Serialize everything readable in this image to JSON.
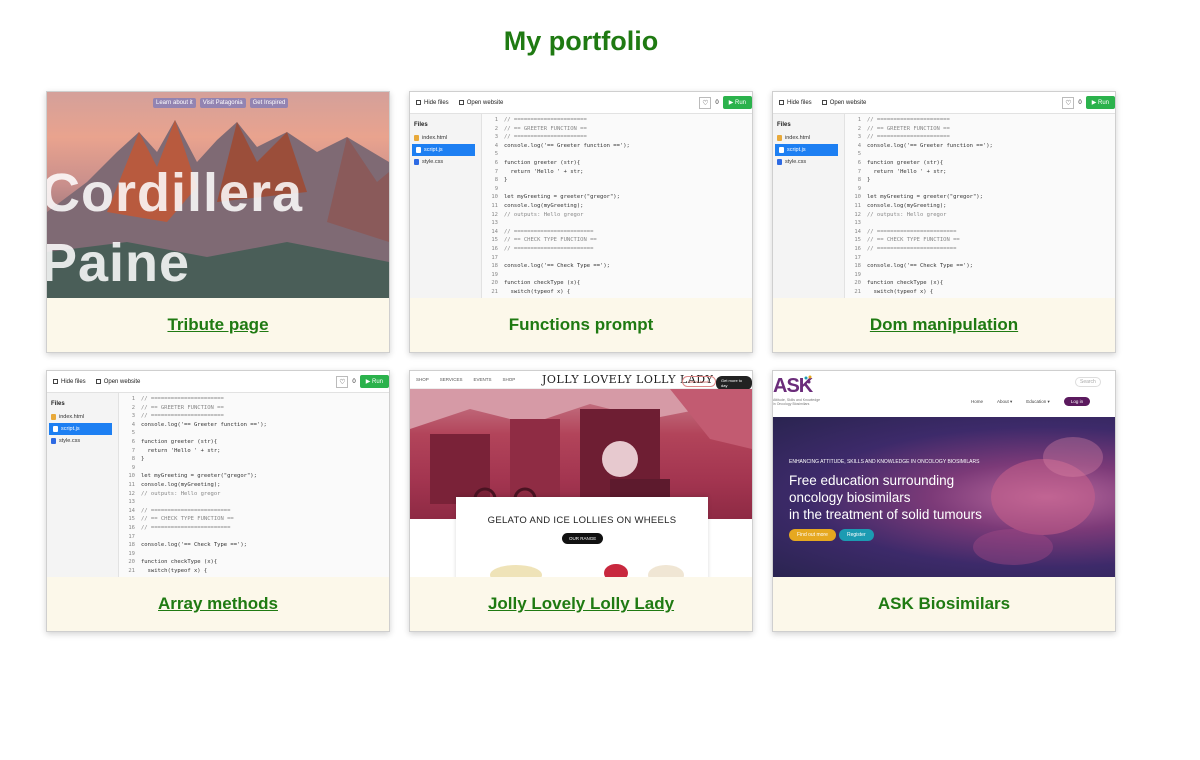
{
  "page": {
    "title": "My portfolio"
  },
  "colors": {
    "title_green": "#1f7a12",
    "card_bg": "#fcf8ea"
  },
  "cards": [
    {
      "caption": "Tribute page",
      "link": true,
      "thumb": {
        "nav": [
          "Learn about it",
          "Visit Patagonia",
          "Get Inspired"
        ],
        "heading_lines": [
          "Cordillera",
          "Paine"
        ]
      }
    },
    {
      "caption": "Functions prompt",
      "link": false
    },
    {
      "caption": "Dom manipulation",
      "link": true
    },
    {
      "caption": "Array methods",
      "link": true
    },
    {
      "caption": "Jolly Lovely Lolly Lady",
      "link": true,
      "thumb": {
        "menu": [
          "SHOP",
          "SERVICES",
          "EVENTS",
          "SHOP"
        ],
        "logo": "JOLLY LOVELY LOLLY LADY",
        "pill1": "Get in touch",
        "pill2": "Get more to day",
        "box_title": "GELATO AND ICE LOLLIES ON WHEELS",
        "box_button": "OUR RANGE"
      }
    },
    {
      "caption": "ASK Biosimilars",
      "link": false,
      "thumb": {
        "logo": "ASK",
        "logo_sub": "Attitude, Skills and Knowledge in Oncology Biosimilars",
        "search": "Search",
        "menu": [
          "Home",
          "About ▾",
          "Education ▾"
        ],
        "login": "Log in",
        "tagline": "ENHANCING ATTITUDE, SKILLS AND KNOWLEDGE IN ONCOLOGY BIOSIMILARS",
        "heading_lines": [
          "Free education surrounding",
          "oncology biosimilars",
          "in the treatment of solid tumours"
        ],
        "btn1": "Find out more",
        "btn2": "Register"
      }
    }
  ],
  "editor": {
    "hide_files": "Hide files",
    "open_website": "Open website",
    "like_count": "0",
    "run": "Run",
    "files_header": "Files",
    "files": [
      "index.html",
      "script.js",
      "style.css"
    ],
    "lines": [
      {
        "n": "1",
        "t": "// ======================",
        "c": true
      },
      {
        "n": "2",
        "t": "// == GREETER FUNCTION ==",
        "c": true
      },
      {
        "n": "3",
        "t": "// ======================",
        "c": true
      },
      {
        "n": "4",
        "t": "console.log('== Greeter function ==');",
        "c": false
      },
      {
        "n": "5",
        "t": "",
        "c": false
      },
      {
        "n": "6",
        "t": "function greeter (str){",
        "c": false
      },
      {
        "n": "7",
        "t": "  return 'Hello ' + str;",
        "c": false
      },
      {
        "n": "8",
        "t": "}",
        "c": false
      },
      {
        "n": "9",
        "t": "",
        "c": false
      },
      {
        "n": "10",
        "t": "let myGreeting = greeter(\"gregor\");",
        "c": false
      },
      {
        "n": "11",
        "t": "console.log(myGreeting);",
        "c": false
      },
      {
        "n": "12",
        "t": "// outputs: Hello gregor",
        "c": true
      },
      {
        "n": "13",
        "t": "",
        "c": false
      },
      {
        "n": "14",
        "t": "// ========================",
        "c": true
      },
      {
        "n": "15",
        "t": "// == CHECK TYPE FUNCTION ==",
        "c": true
      },
      {
        "n": "16",
        "t": "// ========================",
        "c": true
      },
      {
        "n": "17",
        "t": "",
        "c": false
      },
      {
        "n": "18",
        "t": "console.log('== Check Type ==');",
        "c": false
      },
      {
        "n": "19",
        "t": "",
        "c": false
      },
      {
        "n": "20",
        "t": "function checkType (x){",
        "c": false
      },
      {
        "n": "21",
        "t": "  switch(typeof x) {",
        "c": false
      }
    ]
  }
}
